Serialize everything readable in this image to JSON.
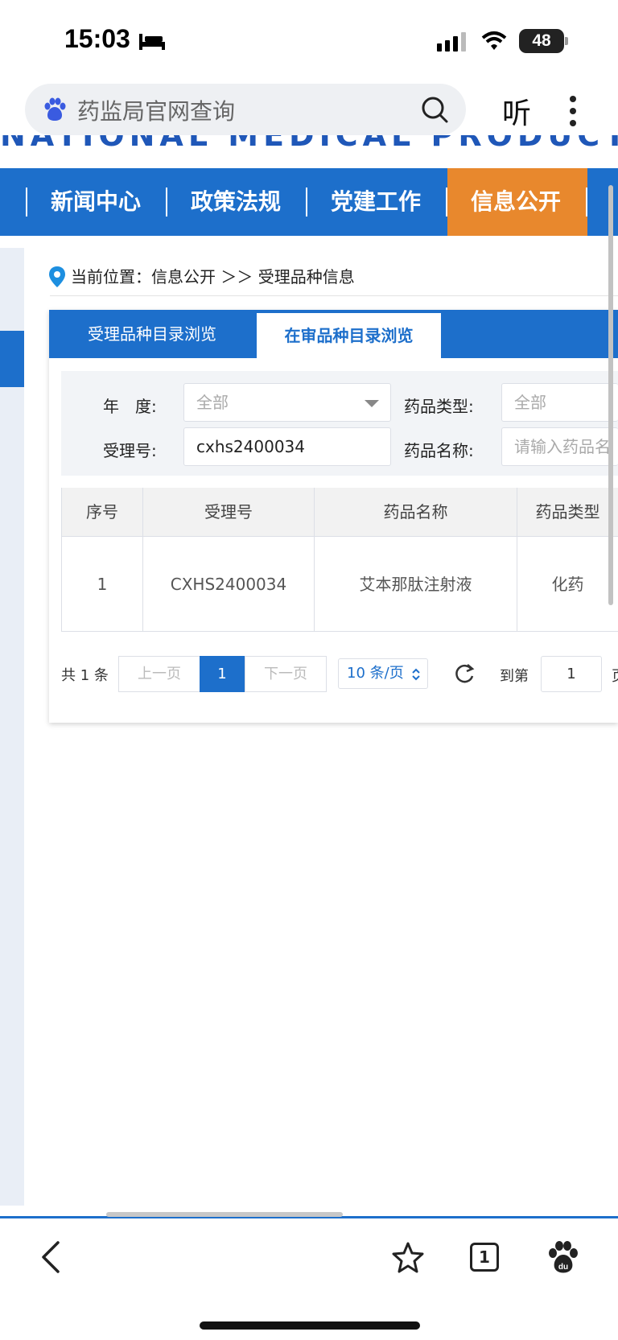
{
  "status": {
    "time": "15:03",
    "battery": "48"
  },
  "search": {
    "query": "药监局官网查询",
    "listen_label": "听"
  },
  "nav": {
    "items": [
      "新闻中心",
      "政策法规",
      "党建工作",
      "信息公开"
    ],
    "active": "信息公开"
  },
  "breadcrumb": "当前位置：信息公开 ＞＞ 受理品种信息",
  "tabs": [
    "受理品种目录浏览",
    "在审品种目录浏览"
  ],
  "filters": {
    "year_label": "年　度:",
    "year_value": "全部",
    "drug_type_label": "药品类型:",
    "drug_type_value": "全部",
    "accept_no_label": "受理号:",
    "accept_no_value": "cxhs2400034",
    "drug_name_label": "药品名称:",
    "drug_name_placeholder": "请输入药品名"
  },
  "table": {
    "headers": [
      "序号",
      "受理号",
      "药品名称",
      "药品类型"
    ],
    "rows": [
      [
        "1",
        "CXHS2400034",
        "艾本那肽注射液",
        "化药"
      ]
    ]
  },
  "pagination": {
    "total": "共 1 条",
    "prev": "上一页",
    "current": "1",
    "next": "下一页",
    "page_size": "10 条/页",
    "goto_label": "到第",
    "goto_value": "1",
    "page_suffix": "页"
  },
  "bottom": {
    "tab_count": "1"
  },
  "colors": {
    "primary": "#1d6fcb",
    "active_nav": "#e8882d"
  },
  "icons": [
    "bed-icon",
    "signal-icon",
    "wifi-icon",
    "baidu-icon",
    "search-icon",
    "more-icon",
    "location-pin-icon",
    "chevron-down-icon",
    "refresh-icon",
    "back-icon",
    "star-icon",
    "tabs-icon",
    "paw-icon"
  ]
}
